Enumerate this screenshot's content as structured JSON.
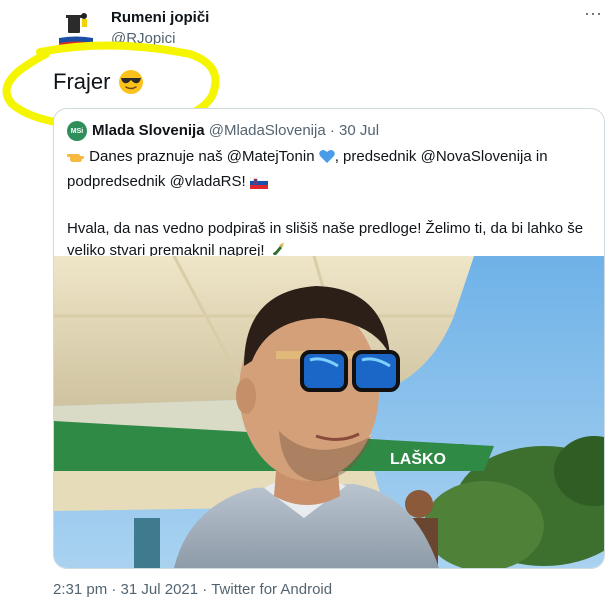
{
  "author": {
    "name": "Rumeni jopiči",
    "handle": "@RJopici"
  },
  "tweet": {
    "text": "Frajer",
    "emoji": "smiling-face-with-sunglasses"
  },
  "quoted_tweet": {
    "avatar_label": "MSi",
    "name": "Mlada Slovenija",
    "handle": "@MladaSlovenija",
    "separator": "·",
    "date": "30 Jul",
    "line1_pre": "Danes praznuje naš",
    "mention1": "@MatejTonin",
    "line1_mid": ", predsednik",
    "mention2": "@NovaSlovenija",
    "line1_post": "in",
    "line2_pre": "podpredsednik",
    "mention3": "@vladaRS",
    "line2_post": "!",
    "para2": "Hvala, da nas vedno podpiraš in slišiš naše predloge! Želimo ti, da bi lahko še veliko stvari premaknil naprej!",
    "photo_sign_text": "LAŠKO"
  },
  "footer": {
    "time": "2:31 pm",
    "separator1": "·",
    "date": "31 Jul 2021",
    "separator2": "·",
    "source": "Twitter for Android"
  },
  "colors": {
    "marker": "#f5f500",
    "secondary_text": "#536471",
    "border": "#cfd9de",
    "heart": "#4a9ce8"
  }
}
